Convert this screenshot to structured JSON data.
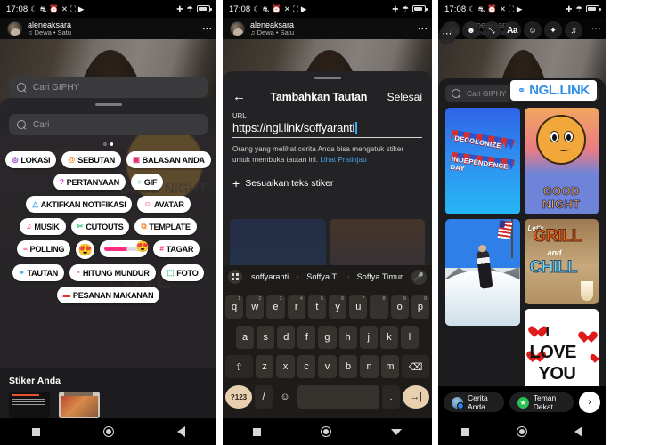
{
  "status_bar": {
    "time": "17:08",
    "left_icons": [
      "moon-icon",
      "dnd-icon",
      "alarm-icon",
      "mute-icon",
      "screenshot-icon",
      "play-icon"
    ],
    "right_icons": [
      "airplane-icon",
      "wifi-icon",
      "battery-icon"
    ]
  },
  "account": {
    "username": "aleneaksara",
    "music_note": "♫",
    "song": "Dewa • Satu",
    "menu": "⋮"
  },
  "panel1": {
    "giphy_search_placeholder": "Cari GIPHY",
    "search_placeholder": "Cari",
    "page_dots": 2,
    "active_dot": 1,
    "stickers": [
      {
        "label": "LOKASI",
        "icon": "location-pin-icon",
        "glyph": "◎",
        "color": "#8a3ab9"
      },
      {
        "label": "SEBUTAN",
        "icon": "mention-icon",
        "glyph": "@",
        "color": "#f58529"
      },
      {
        "label": "BALASAN ANDA",
        "icon": "camera-icon",
        "glyph": "▣",
        "color": "#e1306c"
      },
      {
        "label": "PERTANYAAN",
        "icon": "question-icon",
        "glyph": "?",
        "color": "#d63bd6"
      },
      {
        "label": "GIF",
        "icon": "gif-search-icon",
        "glyph": "○",
        "color": "#2ecc71"
      },
      {
        "label": "AKTIFKAN NOTIFIKASI",
        "icon": "bell-icon",
        "glyph": "△",
        "color": "#3fa9f5"
      },
      {
        "label": "AVATAR",
        "icon": "avatar-icon",
        "glyph": "☺",
        "color": "#e1306c"
      },
      {
        "label": "MUSIK",
        "icon": "music-icon",
        "glyph": "♫",
        "color": "#ff2e82"
      },
      {
        "label": "CUTOUTS",
        "icon": "scissors-icon",
        "glyph": "✂",
        "color": "#2ecc71"
      },
      {
        "label": "TEMPLATE",
        "icon": "template-icon",
        "glyph": "⧉",
        "color": "#f58529"
      },
      {
        "label": "POLLING",
        "icon": "poll-icon",
        "glyph": "≡",
        "color": "#ff2e82"
      },
      {
        "label": "#TAGAR",
        "icon": "hashtag-icon",
        "glyph": "#",
        "color": "#ff2e82"
      },
      {
        "label": "TAUTAN",
        "icon": "link-icon",
        "glyph": "⚭",
        "color": "#3fa9f5"
      },
      {
        "label": "HITUNG MUNDUR",
        "icon": "countdown-icon",
        "glyph": "◔",
        "color": "#d63bd6"
      },
      {
        "label": "FOTO",
        "icon": "photo-icon",
        "glyph": "⬚",
        "color": "#2ecc71"
      },
      {
        "label": "PESANAN MAKANAN",
        "icon": "food-delivery-icon",
        "glyph": "▬",
        "color": "#e4342a"
      }
    ],
    "emoji_round": "😍",
    "emoji_slider": "😍",
    "your_stickers_title": "Stiker Anda",
    "background_text": [
      "DECOLONIZE",
      "INDEPENDENCE",
      "GOOD NIGHT",
      "GRILL",
      "LOVE"
    ]
  },
  "panel2": {
    "back_icon": "back-arrow-icon",
    "title": "Tambahkan Tautan",
    "done_label": "Selesai",
    "url_label": "URL",
    "url_value": "https://ngl.link/soffyaranti",
    "helper_text": "Orang yang melihat cerita Anda bisa mengetuk stiker untuk membuka tautan ini.",
    "preview_link": "Lihat Pratinjau",
    "customize_label": "Sesuaikan teks stiker",
    "customize_plus": "+",
    "keyboard": {
      "suggestions": [
        "soffyaranti",
        "Soffya TI",
        "Soffya Timur"
      ],
      "grid_icon": "keyboard-switch-icon",
      "mic_icon": "microphone-icon",
      "row1": [
        {
          "key": "q",
          "num": "1"
        },
        {
          "key": "w",
          "num": "2"
        },
        {
          "key": "e",
          "num": "3"
        },
        {
          "key": "r",
          "num": "4"
        },
        {
          "key": "t",
          "num": "5"
        },
        {
          "key": "y",
          "num": "6"
        },
        {
          "key": "u",
          "num": "7"
        },
        {
          "key": "i",
          "num": "8"
        },
        {
          "key": "o",
          "num": "9"
        },
        {
          "key": "p",
          "num": "0"
        }
      ],
      "row2": [
        "a",
        "s",
        "d",
        "f",
        "g",
        "h",
        "j",
        "k",
        "l"
      ],
      "row3": [
        "z",
        "x",
        "c",
        "v",
        "b",
        "n",
        "m"
      ],
      "shift": "⇧",
      "backspace": "⌫",
      "numeric": "?123",
      "slash": "/",
      "emoji": "☺",
      "period": ".",
      "enter": "→|"
    }
  },
  "panel3": {
    "toolbar": [
      {
        "name": "back-icon",
        "glyph": "‹"
      },
      {
        "name": "add-person-icon",
        "glyph": "☻"
      },
      {
        "name": "crop-icon",
        "glyph": "⤡"
      },
      {
        "name": "text-aa-icon",
        "glyph": "Aa"
      },
      {
        "name": "sticker-icon",
        "glyph": "☺"
      },
      {
        "name": "sparkle-icon",
        "glyph": "✦"
      },
      {
        "name": "music-icon",
        "glyph": "♫"
      },
      {
        "name": "more-icon",
        "glyph": "⋯"
      }
    ],
    "giphy_search_placeholder": "Cari GIPHY",
    "ngl_sticker": {
      "text": "NGL.LINK",
      "icon": "link-icon",
      "color": "#2f8fe8"
    },
    "gif_tiles": [
      {
        "name": "decolonize-independence-day-gif",
        "text1": "DECOLONIZE",
        "text2": "INDEPENDENCE DAY"
      },
      {
        "name": "good-night-sun-gif",
        "text": "GOOD NIGHT"
      },
      {
        "name": "surfer-flag-gif",
        "text": ""
      },
      {
        "name": "lets-grill-and-chill-gif",
        "t1": "Let's",
        "t2": "GRILL",
        "t3": "and",
        "t4": "CHILL"
      },
      {
        "name": "i-love-you-gif",
        "w1": "I",
        "w2": "LOVE",
        "w3": "YOU"
      }
    ],
    "bottom": {
      "story_label": "Cerita Anda",
      "close_friends_label": "Teman Dekat",
      "next_icon": "chevron-right-icon",
      "next_glyph": "›"
    }
  },
  "nav_bar": {
    "recents": "recents-square-icon",
    "home": "home-circle-icon",
    "back": "back-triangle-icon"
  }
}
